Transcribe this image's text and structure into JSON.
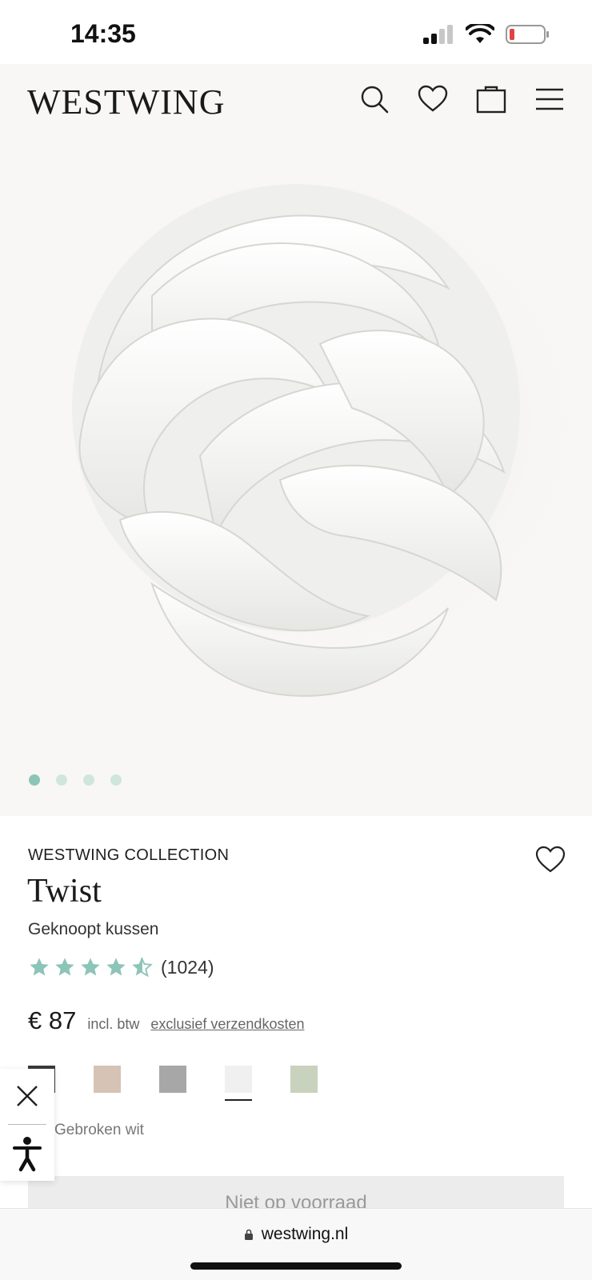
{
  "status": {
    "time": "14:35",
    "battery_color": "#e04343"
  },
  "header": {
    "logo": "WESTWING",
    "icons": [
      "search-icon",
      "heart-icon",
      "bag-icon",
      "menu-icon"
    ]
  },
  "hero": {
    "image": "knot-cushion-photo",
    "slides": 4,
    "active_slide": 1,
    "dot_active_color": "#8cc5b7",
    "dot_color": "#cfe6df"
  },
  "product": {
    "brand": "WESTWING COLLECTION",
    "name": "Twist",
    "subtitle": "Geknoopt kussen",
    "rating": 4.5,
    "rating_count": "(1024)",
    "price": "€ 87",
    "vat_note": "incl. btw",
    "shipping_link": "exclusief verzendkosten",
    "swatches": [
      {
        "color": "#3a3a3a",
        "selected": false
      },
      {
        "color": "#d6c3b6",
        "selected": false
      },
      {
        "color": "#a7a7a7",
        "selected": false
      },
      {
        "color": "#f0f0f0",
        "selected": true
      },
      {
        "color": "#c8d2bd",
        "selected": false
      }
    ],
    "selected_color_label": "Gebroken wit",
    "cta_label": "Niet op voorraad"
  },
  "accessibility": {
    "close_icon": "close-icon",
    "person_icon": "accessibility-icon"
  },
  "browser": {
    "url": "westwing.nl"
  },
  "colors": {
    "star": "#8cc5b7",
    "cta_bg": "#ececec"
  }
}
